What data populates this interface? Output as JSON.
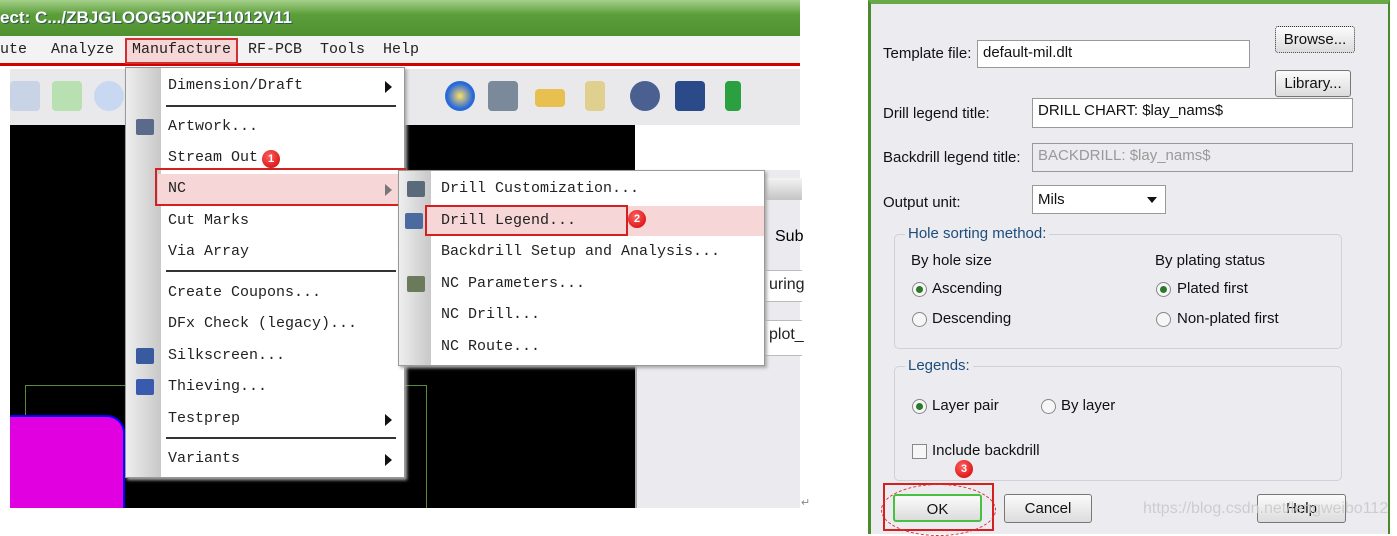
{
  "window": {
    "title": "ect: C.../ZBJGLOOG5ON2F11012V11"
  },
  "menubar": {
    "items": [
      "ute",
      "Analyze",
      "Manufacture",
      "RF-PCB",
      "Tools",
      "Help"
    ],
    "active": "Manufacture"
  },
  "manufacture_menu": {
    "items": [
      {
        "label": "Dimension/Draft",
        "submenu": true
      },
      {
        "label": "Artwork..."
      },
      {
        "label": "Stream Out"
      },
      {
        "label": "NC",
        "submenu": true,
        "highlighted": true
      },
      {
        "label": "Cut Marks"
      },
      {
        "label": "Via Array"
      },
      {
        "label": "Create Coupons..."
      },
      {
        "label": "DFx Check (legacy)..."
      },
      {
        "label": "Silkscreen..."
      },
      {
        "label": "Thieving..."
      },
      {
        "label": "Testprep",
        "submenu": true
      },
      {
        "label": "Variants",
        "submenu": true
      }
    ]
  },
  "nc_submenu": {
    "items": [
      {
        "label": "Drill Customization..."
      },
      {
        "label": "Drill Legend...",
        "highlighted": true
      },
      {
        "label": "Backdrill Setup and Analysis..."
      },
      {
        "label": "NC Parameters..."
      },
      {
        "label": "NC Drill..."
      },
      {
        "label": "NC Route..."
      }
    ]
  },
  "right_panel": {
    "texts": [
      "Sub",
      "uring",
      "plot_"
    ]
  },
  "steps": [
    "1",
    "2",
    "3"
  ],
  "dialog": {
    "template_file_label": "Template file:",
    "template_file_value": "default-mil.dlt",
    "browse": "Browse...",
    "library": "Library...",
    "drill_title_label": "Drill legend title:",
    "drill_title_value": "DRILL CHART: $lay_nams$",
    "backdrill_title_label": "Backdrill legend title:",
    "backdrill_title_value": "BACKDRILL: $lay_nams$",
    "output_unit_label": "Output unit:",
    "output_unit_value": "Mils",
    "hole_sorting": {
      "title": "Hole sorting method:",
      "by_size": "By hole size",
      "ascending": "Ascending",
      "descending": "Descending",
      "size_selected": "Ascending",
      "by_plating": "By plating status",
      "plated_first": "Plated first",
      "nonplated_first": "Non-plated first",
      "plating_selected": "Plated first"
    },
    "legends": {
      "title": "Legends:",
      "layer_pair": "Layer pair",
      "by_layer": "By layer",
      "selected": "Layer pair",
      "include_backdrill": "Include backdrill",
      "include_backdrill_checked": false
    },
    "ok": "OK",
    "cancel": "Cancel",
    "help": "Help"
  },
  "watermark": "https://blog.csdn.net/lengweibo112",
  "colors": {
    "title_green": "#4f9130",
    "highlight_red": "#d42020",
    "highlight_pink": "#f6d6d6"
  }
}
